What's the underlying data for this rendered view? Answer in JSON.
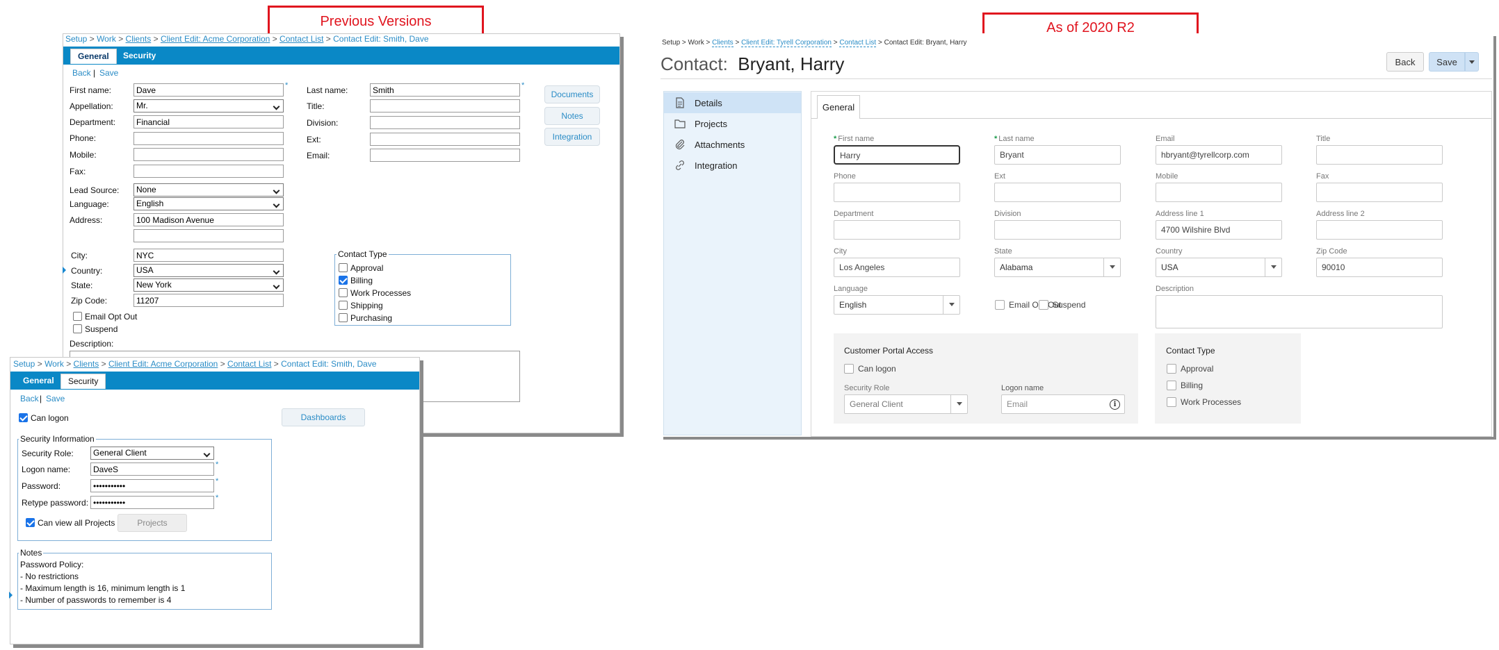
{
  "labels": {
    "previous": "Previous Versions",
    "current": "As of 2020 R2"
  },
  "old_general": {
    "breadcrumb": {
      "setup": "Setup",
      "sep": ">",
      "work": "Work",
      "clients": "Clients",
      "client_edit": "Client Edit: Acme Corporation",
      "contact_list": "Contact List",
      "current": "Contact Edit: Smith, Dave"
    },
    "tabs": [
      "General",
      "Security"
    ],
    "back": "Back",
    "save": "Save",
    "pipe": "|",
    "fields": {
      "first_name": {
        "label": "First name:",
        "value": "Dave"
      },
      "appellation": {
        "label": "Appellation:",
        "value": "Mr."
      },
      "department": {
        "label": "Department:",
        "value": "Financial"
      },
      "phone": {
        "label": "Phone:",
        "value": ""
      },
      "mobile": {
        "label": "Mobile:",
        "value": ""
      },
      "fax": {
        "label": "Fax:",
        "value": ""
      },
      "lead_source": {
        "label": "Lead Source:",
        "value": "None"
      },
      "language": {
        "label": "Language:",
        "value": "English"
      },
      "address": {
        "label": "Address:",
        "value": "100 Madison Avenue",
        "value2": ""
      },
      "city": {
        "label": "City:",
        "value": "NYC"
      },
      "country": {
        "label": "Country:",
        "value": "USA"
      },
      "state": {
        "label": "State:",
        "value": "New York"
      },
      "zip": {
        "label": "Zip Code:",
        "value": "11207"
      },
      "last_name": {
        "label": "Last name:",
        "value": "Smith"
      },
      "title": {
        "label": "Title:",
        "value": ""
      },
      "division": {
        "label": "Division:",
        "value": ""
      },
      "ext": {
        "label": "Ext:",
        "value": ""
      },
      "email": {
        "label": "Email:",
        "value": ""
      }
    },
    "email_opt_out": "Email Opt Out",
    "suspend": "Suspend",
    "description": "Description:",
    "side_buttons": [
      "Documents",
      "Notes",
      "Integration"
    ],
    "contact_type": {
      "legend": "Contact Type",
      "items": [
        {
          "label": "Approval",
          "checked": false
        },
        {
          "label": "Billing",
          "checked": true
        },
        {
          "label": "Work Processes",
          "checked": false
        },
        {
          "label": "Shipping",
          "checked": false
        },
        {
          "label": "Purchasing",
          "checked": false
        }
      ]
    }
  },
  "old_security": {
    "breadcrumb": {
      "setup": "Setup",
      "sep": ">",
      "work": "Work",
      "clients": "Clients",
      "client_edit": "Client Edit: Acme Corporation",
      "contact_list": "Contact List",
      "current": "Contact Edit: Smith, Dave"
    },
    "tabs": [
      "General",
      "Security"
    ],
    "back": "Back",
    "save": "Save",
    "pipe": "|",
    "can_logon": "Can logon",
    "dashboards": "Dashboards",
    "security_info": {
      "legend": "Security Information",
      "role_label": "Security Role:",
      "role_value": "General Client",
      "logon_label": "Logon name:",
      "logon_value": "DaveS",
      "password_label": "Password:",
      "password_value": "•••••••••••",
      "retype_label": "Retype password:",
      "retype_value": "•••••••••••",
      "can_view": "Can view all Projects",
      "projects": "Projects"
    },
    "notes": {
      "legend": "Notes",
      "lines": [
        "Password Policy:",
        "- No restrictions",
        "- Maximum length is 16, minimum length is 1",
        "- Number of passwords to remember is 4"
      ]
    }
  },
  "new_ui": {
    "breadcrumb": {
      "setup": "Setup",
      "sep": ">",
      "work": "Work",
      "clients": "Clients",
      "client_edit": "Client Edit: Tyrell Corporation",
      "contact_list": "Contact List",
      "current": "Contact Edit: Bryant, Harry"
    },
    "title_prefix": "Contact:",
    "title_name": "Bryant, Harry",
    "back": "Back",
    "save": "Save",
    "sidebar": [
      "Details",
      "Projects",
      "Attachments",
      "Integration"
    ],
    "tab": "General",
    "fields": {
      "first_name": {
        "label": "First name",
        "value": "Harry"
      },
      "last_name": {
        "label": "Last name",
        "value": "Bryant"
      },
      "email": {
        "label": "Email",
        "value": "hbryant@tyrellcorp.com"
      },
      "title": {
        "label": "Title",
        "value": ""
      },
      "phone": {
        "label": "Phone",
        "value": ""
      },
      "ext": {
        "label": "Ext",
        "value": ""
      },
      "mobile": {
        "label": "Mobile",
        "value": ""
      },
      "fax": {
        "label": "Fax",
        "value": ""
      },
      "department": {
        "label": "Department",
        "value": ""
      },
      "division": {
        "label": "Division",
        "value": ""
      },
      "address1": {
        "label": "Address line 1",
        "value": "4700 Wilshire Blvd"
      },
      "address2": {
        "label": "Address line 2",
        "value": ""
      },
      "city": {
        "label": "City",
        "value": "Los Angeles"
      },
      "state": {
        "label": "State",
        "value": "Alabama"
      },
      "country": {
        "label": "Country",
        "value": "USA"
      },
      "zip": {
        "label": "Zip Code",
        "value": "90010"
      },
      "language": {
        "label": "Language",
        "value": "English"
      },
      "description": {
        "label": "Description",
        "value": ""
      }
    },
    "email_opt_out": "Email Opt Out",
    "suspend": "Suspend",
    "portal": {
      "header": "Customer Portal Access",
      "can_logon": "Can logon",
      "role_label": "Security Role",
      "role_value": "General Client",
      "logon_label": "Logon name",
      "logon_placeholder": "Email"
    },
    "contact_type": {
      "header": "Contact Type",
      "items": [
        "Approval",
        "Billing",
        "Work Processes"
      ]
    }
  }
}
